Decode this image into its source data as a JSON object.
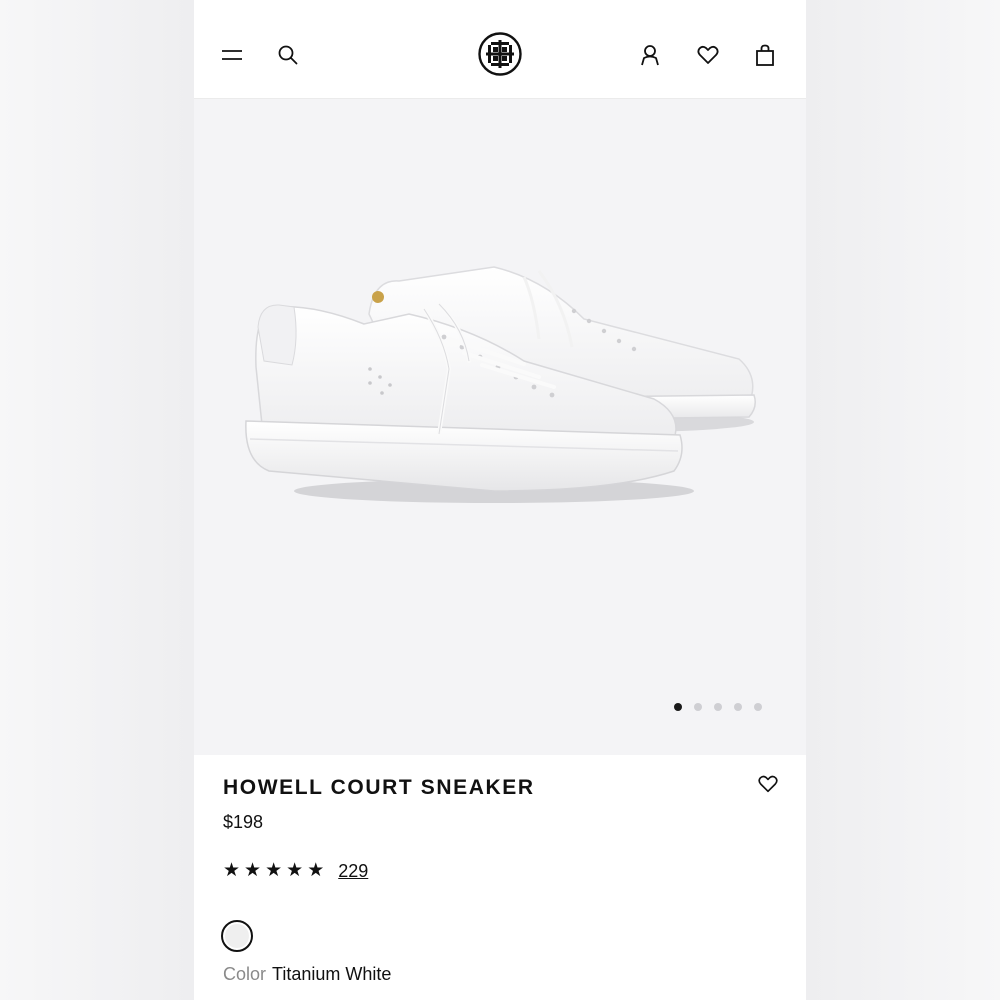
{
  "header": {
    "menu_icon": "menu-icon",
    "search_icon": "search-icon",
    "logo": "brand-logo",
    "account_icon": "account-icon",
    "wishlist_icon": "heart-icon",
    "bag_icon": "shopping-bag-icon"
  },
  "gallery": {
    "image": "white leather sneakers pair",
    "slides": 5,
    "active_slide": 1
  },
  "product": {
    "title": "HOWELL COURT SNEAKER",
    "price": "$198",
    "rating_stars": 5,
    "review_count": "229",
    "color_label": "Color",
    "color_value": "Titanium White"
  },
  "colors": {
    "accent": "#111111",
    "hero_bg": "#f4f4f6",
    "swatch": "#efefef",
    "muted_text": "#8a8a8a"
  }
}
